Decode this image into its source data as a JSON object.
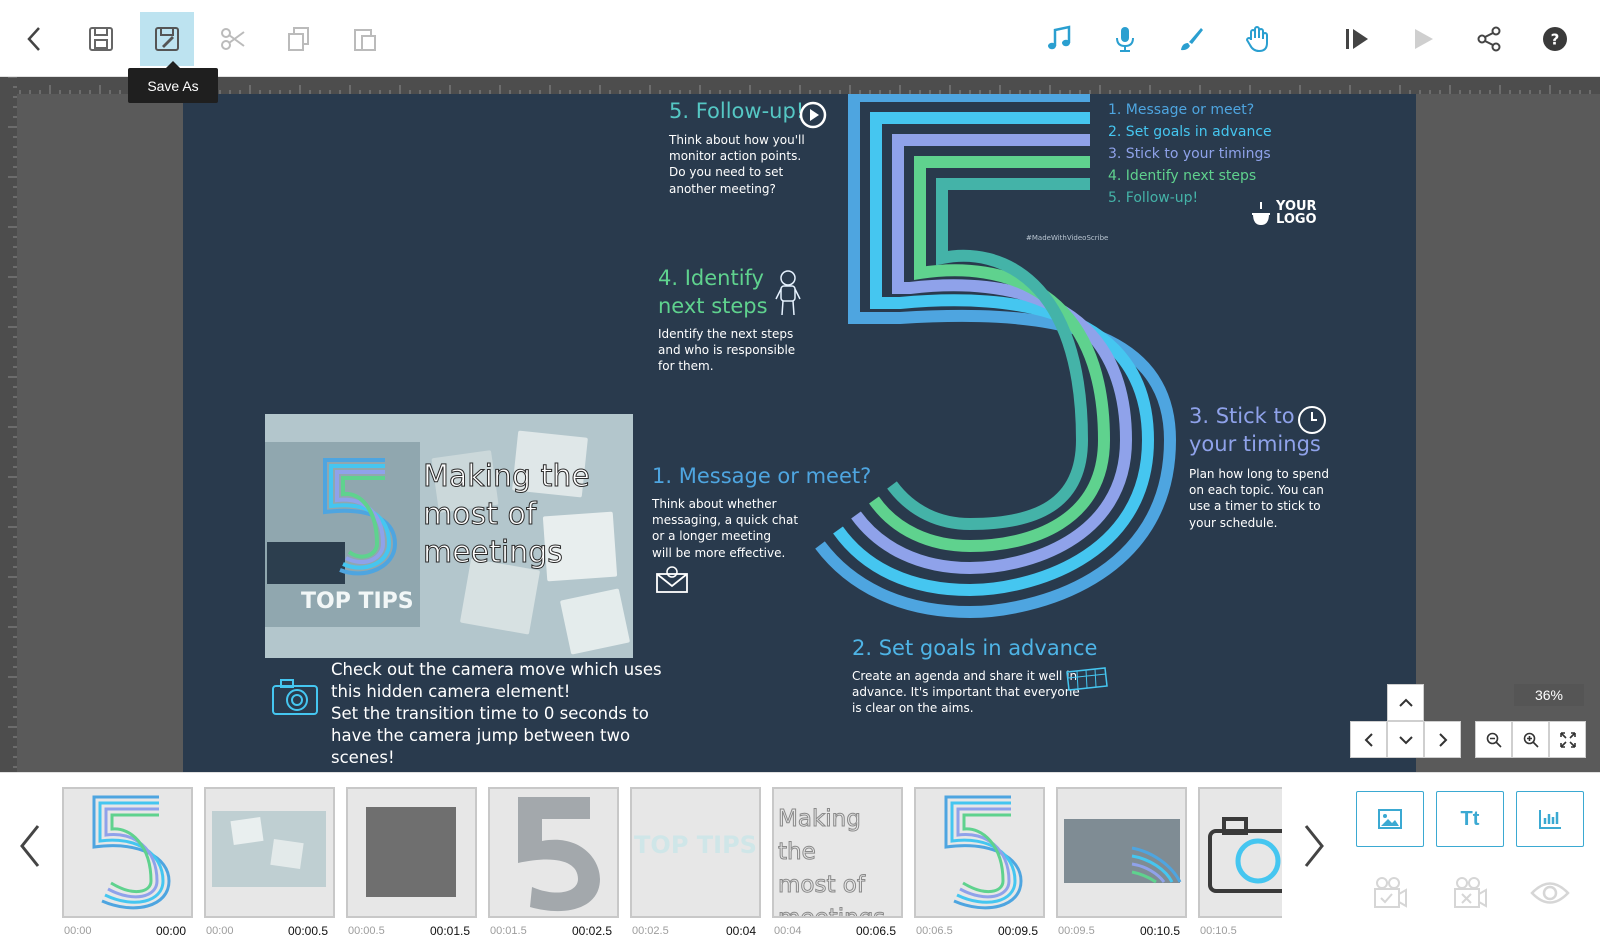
{
  "toolbar": {
    "tooltip": "Save As",
    "icons": [
      "back-icon",
      "save-icon",
      "save-as-icon",
      "cut-icon",
      "copy-icon",
      "paste-icon",
      "music-icon",
      "microphone-icon",
      "brush-icon",
      "hand-icon",
      "play-from-start-icon",
      "play-icon",
      "share-icon",
      "help-icon"
    ],
    "accent": "#3ba9d2"
  },
  "canvas": {
    "step5_title": "5. Follow-up!",
    "step5_body": [
      "Think about how you'll",
      "monitor action points.",
      "Do you need to set",
      "another meeting?"
    ],
    "step4_title": [
      "4. Identify",
      "next steps"
    ],
    "step4_body": [
      "Identify the next steps",
      "and who is responsible",
      "for them."
    ],
    "step1_title": "1. Message or meet?",
    "step1_body": [
      "Think about whether",
      "messaging, a quick chat",
      "or a longer meeting",
      "will be more effective."
    ],
    "step2_title": "2. Set goals in advance",
    "step2_body": [
      "Create an agenda and share it well in",
      "advance. It's important that everyone",
      "is clear on the aims."
    ],
    "step3_title": [
      "3. Stick to",
      "your timings"
    ],
    "step3_body": [
      "Plan how long to spend",
      "on each topic. You can",
      "use a timer to stick to",
      "your schedule."
    ],
    "legend": [
      "1. Message or meet?",
      "2. Set goals in advance",
      "3. Stick to your timings",
      "4. Identify next steps",
      "5. Follow-up!"
    ],
    "legend_colors": [
      "#4ea5e0",
      "#45c6f0",
      "#8fa2ea",
      "#5fd28e",
      "#44b3a8"
    ],
    "watermark": "#MadeWithVideoScribe",
    "logo_line1": "YOUR",
    "logo_line2": "LOGO",
    "photo_big": "5",
    "photo_title": [
      "Making the",
      "most of",
      "meetings"
    ],
    "photo_subtitle": "TOP TIPS",
    "camera_note": [
      "Check out the camera move which uses",
      "this hidden camera element!",
      "Set the transition time to 0 seconds to",
      "have the camera jump between two",
      "scenes!"
    ],
    "background": "#293a4d"
  },
  "view": {
    "zoom": "36%"
  },
  "timeline": {
    "thumbs": [
      {
        "type": "five-color",
        "start": "00:00",
        "end": "00:00"
      },
      {
        "type": "photo",
        "start": "00:00",
        "end": "00:00.5"
      },
      {
        "type": "gray-square",
        "start": "00:00.5",
        "end": "00:01.5"
      },
      {
        "type": "five-gray",
        "start": "00:01.5",
        "end": "00:02.5"
      },
      {
        "type": "text",
        "text": "TOP TIPS",
        "start": "00:02.5",
        "end": "00:04"
      },
      {
        "type": "text-outline",
        "text": [
          "Making the",
          "most of",
          "meetings"
        ],
        "start": "00:04",
        "end": "00:06.5"
      },
      {
        "type": "five-color",
        "start": "00:06.5",
        "end": "00:09.5"
      },
      {
        "type": "rect-stripes",
        "start": "00:09.5",
        "end": "00:10.5"
      },
      {
        "type": "camera",
        "start": "00:10.5",
        "end": ""
      }
    ],
    "add_buttons": [
      "image-icon",
      "Tt",
      "chart-icon"
    ],
    "lower_icons": [
      "camera-check-icon",
      "camera-cross-icon",
      "eye-icon"
    ]
  }
}
